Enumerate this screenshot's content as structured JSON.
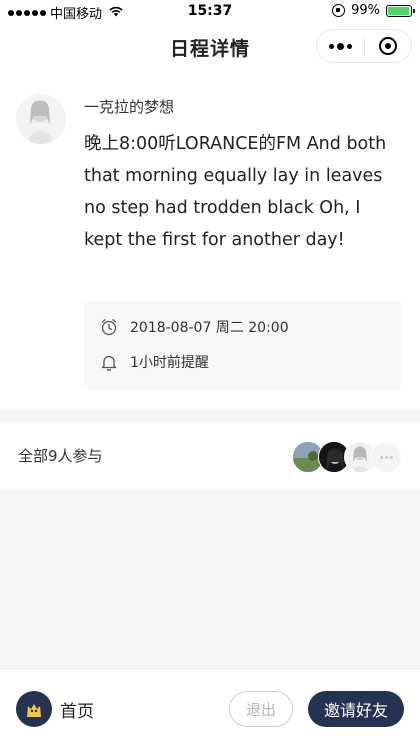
{
  "status_bar": {
    "carrier": "中国移动",
    "time": "15:37",
    "battery": "99%",
    "battery_level": 0.99
  },
  "nav": {
    "title": "日程详情"
  },
  "post": {
    "author": "一克拉的梦想",
    "content": "晚上8:00听LORANCE的FM And both that morning equally lay in leaves no step had trodden black Oh, I kept the first for another day!",
    "datetime": "2018-08-07 周二 20:00",
    "reminder": "1小时前提醒"
  },
  "participants": {
    "label": "全部9人参与",
    "avatars": [
      "avatar-1",
      "avatar-2",
      "avatar-3"
    ]
  },
  "footer": {
    "home_label": "首页",
    "exit_label": "退出",
    "invite_label": "邀请好友"
  },
  "colors": {
    "primary_dark": "#263252",
    "battery_green": "#4cd964",
    "muted_text": "#b5b5b5"
  },
  "icons": {
    "alarm": "alarm-clock-icon",
    "bell": "bell-icon",
    "more": "more-icon",
    "target": "target-icon"
  }
}
